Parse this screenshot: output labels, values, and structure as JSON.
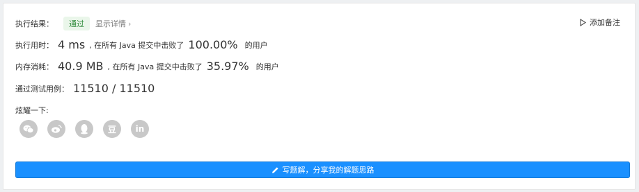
{
  "result": {
    "label": "执行结果：",
    "status": "通过",
    "details_link": "显示详情",
    "details_chevron": "›"
  },
  "note_button": {
    "label": "添加备注",
    "icon": "play-outline-icon"
  },
  "runtime": {
    "label": "执行用时：",
    "value": "4 ms",
    "mid_text": ", 在所有 Java 提交中击败了",
    "percent": "100.00%",
    "suffix": "的用户"
  },
  "memory": {
    "label": "内存消耗：",
    "value": "40.9 MB",
    "mid_text": ", 在所有 Java 提交中击败了",
    "percent": "35.97%",
    "suffix": "的用户"
  },
  "tests": {
    "label": "通过测试用例：",
    "value": "11510 / 11510"
  },
  "share": {
    "label": "炫耀一下:",
    "icons": [
      {
        "name": "wechat-icon"
      },
      {
        "name": "weibo-icon"
      },
      {
        "name": "qq-icon"
      },
      {
        "name": "douban-icon",
        "glyph": "豆"
      },
      {
        "name": "linkedin-icon",
        "glyph": "in"
      }
    ]
  },
  "cta": {
    "label": "写题解，分享我的解题思路",
    "icon": "pencil-icon"
  },
  "colors": {
    "accent": "#1a90ff",
    "success_text": "#2e8a3a",
    "success_bg": "#eaf6ea",
    "icon_gray": "#c8c8c8"
  }
}
